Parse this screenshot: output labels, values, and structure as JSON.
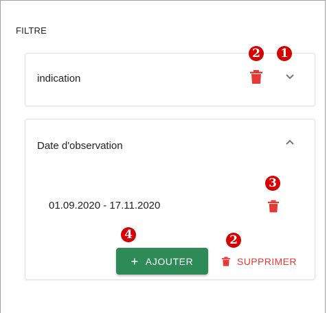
{
  "panel": {
    "title": "FILTRE"
  },
  "filters": [
    {
      "label": "indication",
      "expanded": false,
      "delete_icon": "trash-icon",
      "toggle_icon": "chevron-down-icon"
    },
    {
      "label": "Date d'observation",
      "expanded": true,
      "toggle_icon": "chevron-up-icon",
      "values": [
        {
          "text": "01.09.2020 - 17.11.2020",
          "delete_icon": "trash-icon"
        }
      ]
    }
  ],
  "actions": {
    "add_label": "AJOUTER",
    "add_icon": "plus-icon",
    "delete_label": "SUPPRIMER",
    "delete_icon": "trash-icon"
  },
  "annotations": [
    {
      "marker": "1",
      "glyph": "❶"
    },
    {
      "marker": "2",
      "glyph": "❷"
    },
    {
      "marker": "3",
      "glyph": "❸"
    },
    {
      "marker": "4",
      "glyph": "❹"
    }
  ],
  "colors": {
    "add_button": "#2e8b57",
    "delete_red": "#e53935",
    "annotation_red": "#d50000",
    "card_border": "#e0e0e0"
  }
}
